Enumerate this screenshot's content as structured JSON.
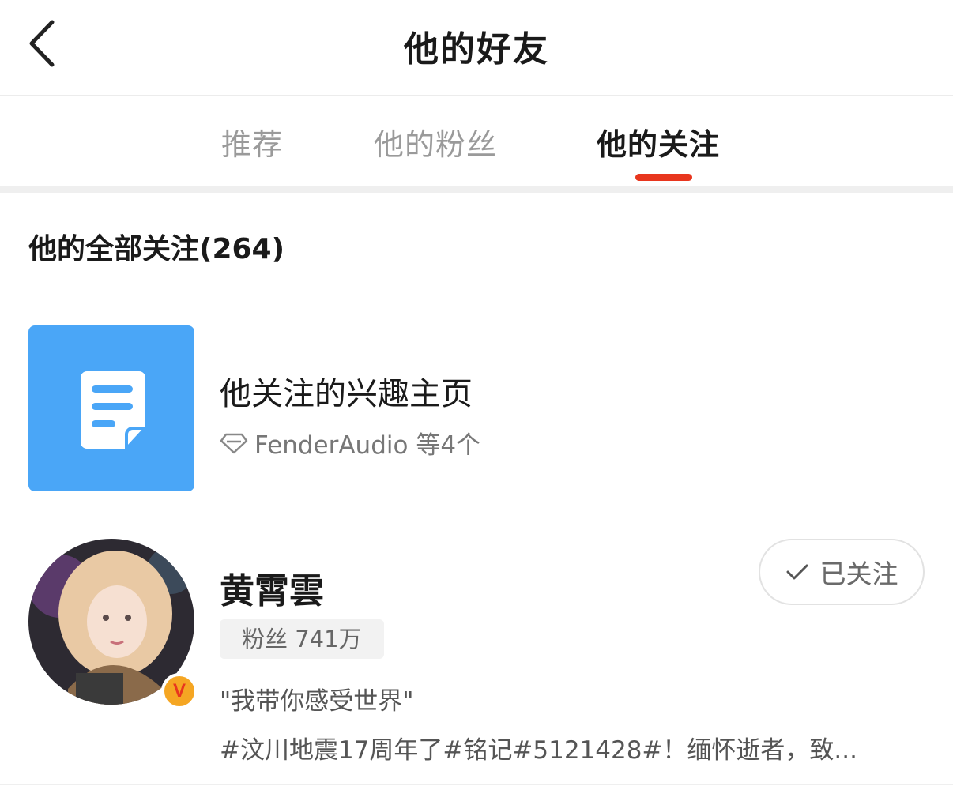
{
  "header": {
    "title": "他的好友",
    "back_icon": "chevron-left-icon"
  },
  "tabs": [
    {
      "label": "推荐",
      "active": false
    },
    {
      "label": "他的粉丝",
      "active": false
    },
    {
      "label": "他的关注",
      "active": true
    }
  ],
  "colors": {
    "accent": "#e8361e",
    "tile_blue": "#4aa6f7",
    "badge_gold": "#f5a623"
  },
  "section": {
    "title": "他的全部关注(264)"
  },
  "interest": {
    "icon": "document-icon",
    "title": "他关注的兴趣主页",
    "sub_icon": "diamond-icon",
    "subtitle": "FenderAudio 等4个"
  },
  "users": [
    {
      "name": "黄霄雲",
      "verified_badge": "V",
      "fans": "粉丝 741万",
      "quote": "\"我带你感受世界\"",
      "desc": "#汶川地震17周年了#铭记#5121428#！缅怀逝者，致...",
      "follow_label": "已关注",
      "follow_icon": "check-icon"
    }
  ]
}
